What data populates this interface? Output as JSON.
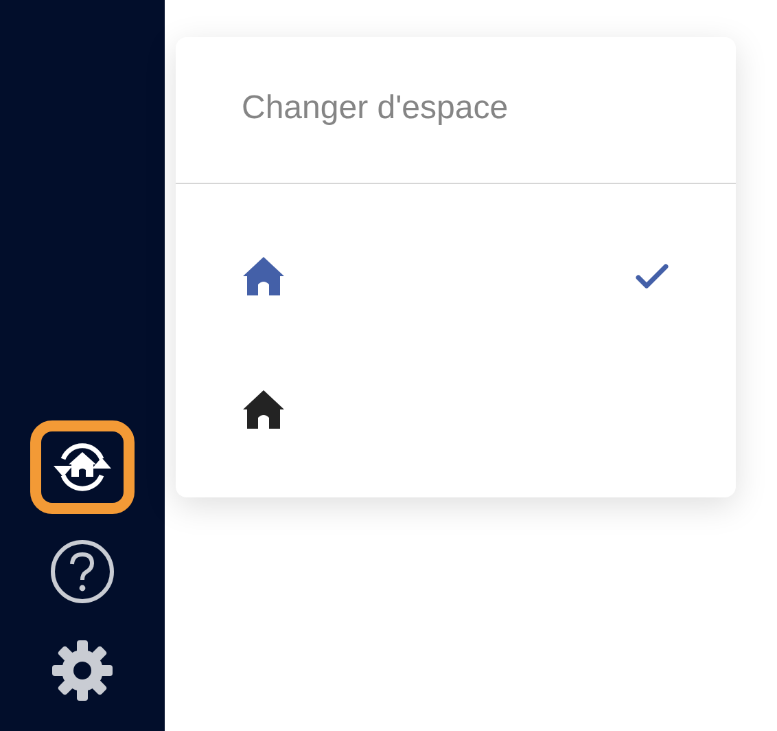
{
  "sidebar": {
    "buttons": [
      {
        "kind": "switch",
        "active": true
      },
      {
        "kind": "help",
        "active": false
      },
      {
        "kind": "settings",
        "active": false
      }
    ]
  },
  "menu": {
    "title": "Changer d'espace",
    "spaces": [
      {
        "selected": true
      },
      {
        "selected": false
      }
    ]
  }
}
